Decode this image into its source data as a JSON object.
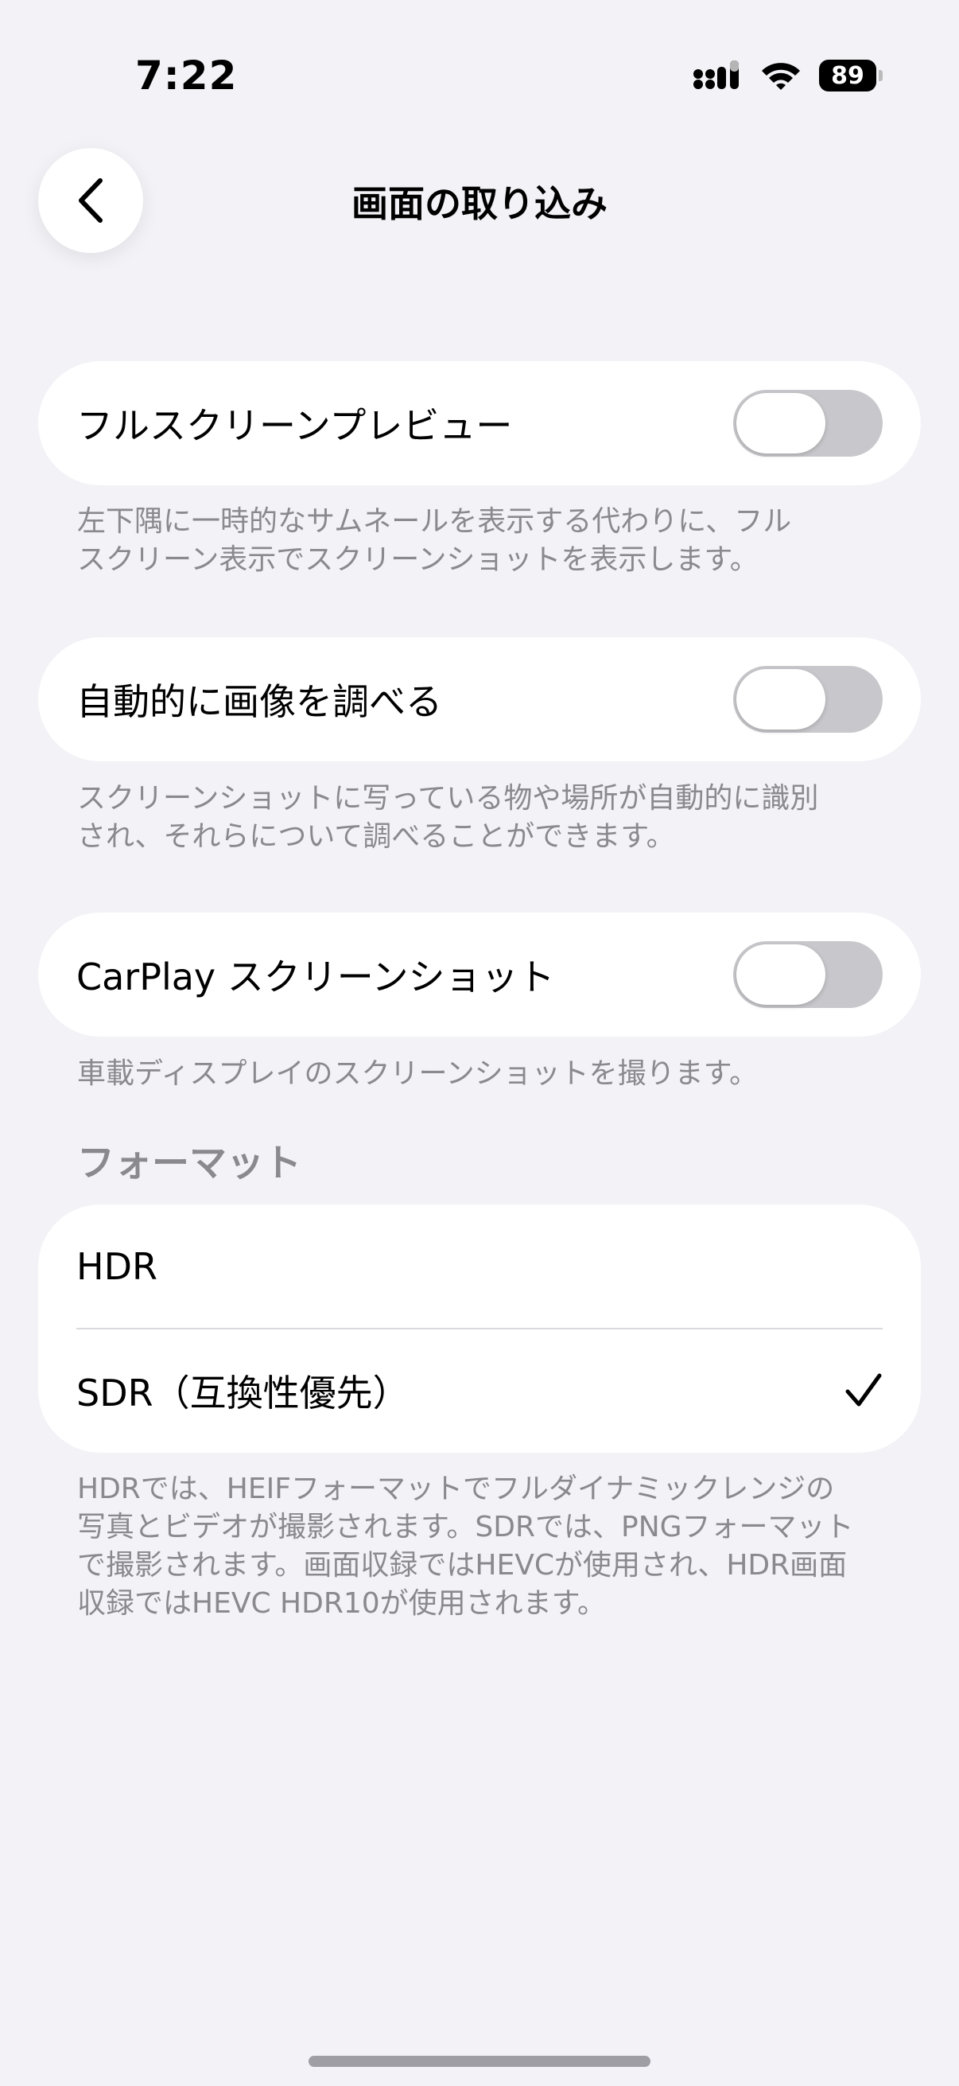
{
  "status_bar": {
    "time": "7:22",
    "battery": "89",
    "icons": [
      "cellular-signal-icon",
      "wifi-icon",
      "battery-icon"
    ]
  },
  "nav": {
    "back_icon": "chevron-left-icon",
    "title": "画面の取り込み"
  },
  "settings": {
    "fullscreen_preview": {
      "label": "フルスクリーンプレビュー",
      "enabled": false,
      "footnote_line1": "左下隅に一時的なサムネールを表示する代わりに、フル",
      "footnote_line2": "スクリーン表示でスクリーンショットを表示します。"
    },
    "auto_lookup": {
      "label": "自動的に画像を調べる",
      "enabled": false,
      "footnote_line1": "スクリーンショットに写っている物や場所が自動的に識別",
      "footnote_line2": "され、それらについて調べることができます。"
    },
    "carplay": {
      "label": "CarPlay スクリーンショット",
      "enabled": false,
      "footnote": "車載ディスプレイのスクリーンショットを撮ります。"
    }
  },
  "format": {
    "header": "フォーマット",
    "options": [
      {
        "label": "HDR",
        "selected": false
      },
      {
        "label": "SDR（互換性優先）",
        "selected": true
      }
    ],
    "checkmark": "✓",
    "footnote_line1": "HDRでは、HEIFフォーマットでフルダイナミックレンジの",
    "footnote_line2": "写真とビデオが撮影されます。SDRでは、PNGフォーマット",
    "footnote_line3": "で撮影されます。画面収録ではHEVCが使用され、HDR画面",
    "footnote_line4": "収録ではHEVC HDR10が使用されます。"
  },
  "colors": {
    "background": "#f2f2f7",
    "card": "#ffffff",
    "toggle_off": "#c8c8cc",
    "secondary_text": "#8a8a8e"
  }
}
